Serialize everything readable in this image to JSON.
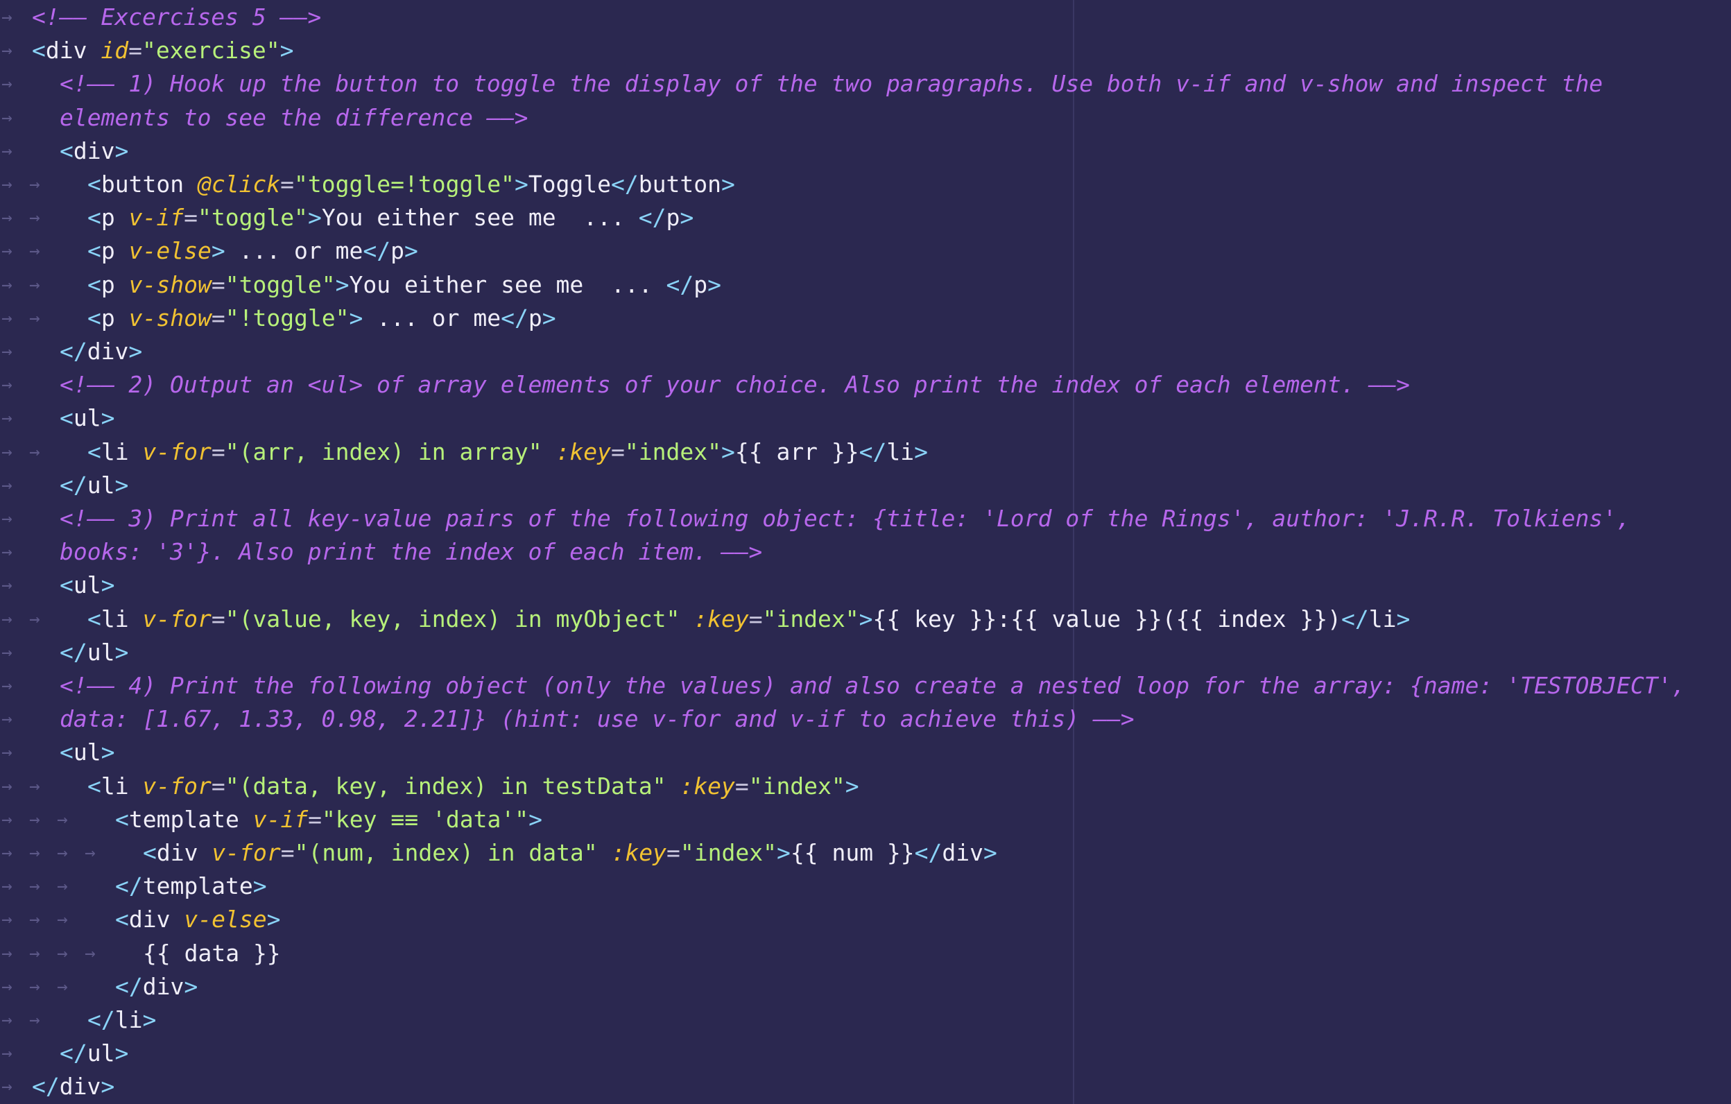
{
  "editor": {
    "indent_glyph": "→",
    "lines": [
      {
        "indent": 0,
        "tokens": [
          {
            "t": "<!—— Excercises 5 ——>",
            "k": "cm"
          }
        ]
      },
      {
        "indent": 0,
        "tokens": [
          {
            "t": "<",
            "k": "br"
          },
          {
            "t": "div ",
            "k": "tg"
          },
          {
            "t": "id",
            "k": "at"
          },
          {
            "t": "=",
            "k": "eq"
          },
          {
            "t": "\"exercise\"",
            "k": "st"
          },
          {
            "t": ">",
            "k": "br"
          }
        ]
      },
      {
        "indent": 1,
        "tokens": [
          {
            "t": "<!—— 1) Hook up the button to toggle the display of the two paragraphs. Use both v-if and v-show and inspect the",
            "k": "cm"
          }
        ]
      },
      {
        "indent": 1,
        "wrap": true,
        "tokens": [
          {
            "t": "elements to see the difference ——>",
            "k": "cm"
          }
        ]
      },
      {
        "indent": 1,
        "tokens": [
          {
            "t": "<",
            "k": "br"
          },
          {
            "t": "div",
            "k": "tg"
          },
          {
            "t": ">",
            "k": "br"
          }
        ]
      },
      {
        "indent": 2,
        "tokens": [
          {
            "t": "<",
            "k": "br"
          },
          {
            "t": "button ",
            "k": "tg"
          },
          {
            "t": "@click",
            "k": "at"
          },
          {
            "t": "=",
            "k": "eq"
          },
          {
            "t": "\"toggle=!toggle\"",
            "k": "st"
          },
          {
            "t": ">",
            "k": "br"
          },
          {
            "t": "Toggle",
            "k": "tx"
          },
          {
            "t": "</",
            "k": "br"
          },
          {
            "t": "button",
            "k": "tg"
          },
          {
            "t": ">",
            "k": "br"
          }
        ]
      },
      {
        "indent": 2,
        "tokens": [
          {
            "t": "<",
            "k": "br"
          },
          {
            "t": "p ",
            "k": "tg"
          },
          {
            "t": "v-if",
            "k": "at"
          },
          {
            "t": "=",
            "k": "eq"
          },
          {
            "t": "\"toggle\"",
            "k": "st"
          },
          {
            "t": ">",
            "k": "br"
          },
          {
            "t": "You either see me  ... ",
            "k": "tx"
          },
          {
            "t": "</",
            "k": "br"
          },
          {
            "t": "p",
            "k": "tg"
          },
          {
            "t": ">",
            "k": "br"
          }
        ]
      },
      {
        "indent": 2,
        "tokens": [
          {
            "t": "<",
            "k": "br"
          },
          {
            "t": "p ",
            "k": "tg"
          },
          {
            "t": "v-else",
            "k": "at"
          },
          {
            "t": ">",
            "k": "br"
          },
          {
            "t": " ... or me",
            "k": "tx"
          },
          {
            "t": "</",
            "k": "br"
          },
          {
            "t": "p",
            "k": "tg"
          },
          {
            "t": ">",
            "k": "br"
          }
        ]
      },
      {
        "indent": 2,
        "tokens": [
          {
            "t": "<",
            "k": "br"
          },
          {
            "t": "p ",
            "k": "tg"
          },
          {
            "t": "v-show",
            "k": "at"
          },
          {
            "t": "=",
            "k": "eq"
          },
          {
            "t": "\"toggle\"",
            "k": "st"
          },
          {
            "t": ">",
            "k": "br"
          },
          {
            "t": "You either see me  ... ",
            "k": "tx"
          },
          {
            "t": "</",
            "k": "br"
          },
          {
            "t": "p",
            "k": "tg"
          },
          {
            "t": ">",
            "k": "br"
          }
        ]
      },
      {
        "indent": 2,
        "tokens": [
          {
            "t": "<",
            "k": "br"
          },
          {
            "t": "p ",
            "k": "tg"
          },
          {
            "t": "v-show",
            "k": "at"
          },
          {
            "t": "=",
            "k": "eq"
          },
          {
            "t": "\"!toggle\"",
            "k": "st"
          },
          {
            "t": ">",
            "k": "br"
          },
          {
            "t": " ... or me",
            "k": "tx"
          },
          {
            "t": "</",
            "k": "br"
          },
          {
            "t": "p",
            "k": "tg"
          },
          {
            "t": ">",
            "k": "br"
          }
        ]
      },
      {
        "indent": 1,
        "tokens": [
          {
            "t": "</",
            "k": "br"
          },
          {
            "t": "div",
            "k": "tg"
          },
          {
            "t": ">",
            "k": "br"
          }
        ]
      },
      {
        "indent": 1,
        "tokens": [
          {
            "t": "<!—— 2) Output an <ul> of array elements of your choice. Also print the index of each element. ——>",
            "k": "cm"
          }
        ]
      },
      {
        "indent": 1,
        "tokens": [
          {
            "t": "<",
            "k": "br"
          },
          {
            "t": "ul",
            "k": "tg"
          },
          {
            "t": ">",
            "k": "br"
          }
        ]
      },
      {
        "indent": 2,
        "tokens": [
          {
            "t": "<",
            "k": "br"
          },
          {
            "t": "li ",
            "k": "tg"
          },
          {
            "t": "v-for",
            "k": "at"
          },
          {
            "t": "=",
            "k": "eq"
          },
          {
            "t": "\"(arr, index) in array\" ",
            "k": "st"
          },
          {
            "t": ":key",
            "k": "at"
          },
          {
            "t": "=",
            "k": "eq"
          },
          {
            "t": "\"index\"",
            "k": "st"
          },
          {
            "t": ">",
            "k": "br"
          },
          {
            "t": "{{ arr }}",
            "k": "tx"
          },
          {
            "t": "</",
            "k": "br"
          },
          {
            "t": "li",
            "k": "tg"
          },
          {
            "t": ">",
            "k": "br"
          }
        ]
      },
      {
        "indent": 1,
        "tokens": [
          {
            "t": "</",
            "k": "br"
          },
          {
            "t": "ul",
            "k": "tg"
          },
          {
            "t": ">",
            "k": "br"
          }
        ]
      },
      {
        "indent": 1,
        "tokens": [
          {
            "t": "<!—— 3) Print all key-value pairs of the following object: {title: 'Lord of the Rings', author: 'J.R.R. Tolkiens',",
            "k": "cm"
          }
        ]
      },
      {
        "indent": 1,
        "wrap": true,
        "tokens": [
          {
            "t": "books: '3'}. Also print the index of each item. ——>",
            "k": "cm"
          }
        ]
      },
      {
        "indent": 1,
        "tokens": [
          {
            "t": "<",
            "k": "br"
          },
          {
            "t": "ul",
            "k": "tg"
          },
          {
            "t": ">",
            "k": "br"
          }
        ]
      },
      {
        "indent": 2,
        "tokens": [
          {
            "t": "<",
            "k": "br"
          },
          {
            "t": "li ",
            "k": "tg"
          },
          {
            "t": "v-for",
            "k": "at"
          },
          {
            "t": "=",
            "k": "eq"
          },
          {
            "t": "\"(value, key, index) in myObject\" ",
            "k": "st"
          },
          {
            "t": ":key",
            "k": "at"
          },
          {
            "t": "=",
            "k": "eq"
          },
          {
            "t": "\"index\"",
            "k": "st"
          },
          {
            "t": ">",
            "k": "br"
          },
          {
            "t": "{{ key }}:{{ value }}({{ index }})",
            "k": "tx"
          },
          {
            "t": "</",
            "k": "br"
          },
          {
            "t": "li",
            "k": "tg"
          },
          {
            "t": ">",
            "k": "br"
          }
        ]
      },
      {
        "indent": 1,
        "tokens": [
          {
            "t": "</",
            "k": "br"
          },
          {
            "t": "ul",
            "k": "tg"
          },
          {
            "t": ">",
            "k": "br"
          }
        ]
      },
      {
        "indent": 1,
        "tokens": [
          {
            "t": "<!—— 4) Print the following object (only the values) and also create a nested loop for the array: {name: 'TESTOBJECT',",
            "k": "cm"
          }
        ]
      },
      {
        "indent": 1,
        "wrap": true,
        "tokens": [
          {
            "t": "data: [1.67, 1.33, 0.98, 2.21]} (hint: use v-for and v-if to achieve this) ——>",
            "k": "cm"
          }
        ]
      },
      {
        "indent": 1,
        "tokens": [
          {
            "t": "<",
            "k": "br"
          },
          {
            "t": "ul",
            "k": "tg"
          },
          {
            "t": ">",
            "k": "br"
          }
        ]
      },
      {
        "indent": 2,
        "tokens": [
          {
            "t": "<",
            "k": "br"
          },
          {
            "t": "li ",
            "k": "tg"
          },
          {
            "t": "v-for",
            "k": "at"
          },
          {
            "t": "=",
            "k": "eq"
          },
          {
            "t": "\"(data, key, index) in testData\" ",
            "k": "st"
          },
          {
            "t": ":key",
            "k": "at"
          },
          {
            "t": "=",
            "k": "eq"
          },
          {
            "t": "\"index\"",
            "k": "st"
          },
          {
            "t": ">",
            "k": "br"
          }
        ]
      },
      {
        "indent": 3,
        "tokens": [
          {
            "t": "<",
            "k": "br"
          },
          {
            "t": "template ",
            "k": "tg"
          },
          {
            "t": "v-if",
            "k": "at"
          },
          {
            "t": "=",
            "k": "eq"
          },
          {
            "t": "\"key ≡≡ 'data'\"",
            "k": "st"
          },
          {
            "t": ">",
            "k": "br"
          }
        ]
      },
      {
        "indent": 4,
        "tokens": [
          {
            "t": "<",
            "k": "br"
          },
          {
            "t": "div ",
            "k": "tg"
          },
          {
            "t": "v-for",
            "k": "at"
          },
          {
            "t": "=",
            "k": "eq"
          },
          {
            "t": "\"(num, index) in data\" ",
            "k": "st"
          },
          {
            "t": ":key",
            "k": "at"
          },
          {
            "t": "=",
            "k": "eq"
          },
          {
            "t": "\"index\"",
            "k": "st"
          },
          {
            "t": ">",
            "k": "br"
          },
          {
            "t": "{{ num }}",
            "k": "tx"
          },
          {
            "t": "</",
            "k": "br"
          },
          {
            "t": "div",
            "k": "tg"
          },
          {
            "t": ">",
            "k": "br"
          }
        ]
      },
      {
        "indent": 3,
        "tokens": [
          {
            "t": "</",
            "k": "br"
          },
          {
            "t": "template",
            "k": "tg"
          },
          {
            "t": ">",
            "k": "br"
          }
        ]
      },
      {
        "indent": 3,
        "tokens": [
          {
            "t": "<",
            "k": "br"
          },
          {
            "t": "div ",
            "k": "tg"
          },
          {
            "t": "v-else",
            "k": "at"
          },
          {
            "t": ">",
            "k": "br"
          }
        ]
      },
      {
        "indent": 4,
        "tokens": [
          {
            "t": "{{ data }}",
            "k": "tx"
          }
        ]
      },
      {
        "indent": 3,
        "tokens": [
          {
            "t": "</",
            "k": "br"
          },
          {
            "t": "div",
            "k": "tg"
          },
          {
            "t": ">",
            "k": "br"
          }
        ]
      },
      {
        "indent": 2,
        "tokens": [
          {
            "t": "</",
            "k": "br"
          },
          {
            "t": "li",
            "k": "tg"
          },
          {
            "t": ">",
            "k": "br"
          }
        ]
      },
      {
        "indent": 1,
        "tokens": [
          {
            "t": "</",
            "k": "br"
          },
          {
            "t": "ul",
            "k": "tg"
          },
          {
            "t": ">",
            "k": "br"
          }
        ]
      },
      {
        "indent": 0,
        "tokens": [
          {
            "t": "</",
            "k": "br"
          },
          {
            "t": "div",
            "k": "tg"
          },
          {
            "t": ">",
            "k": "br"
          }
        ]
      }
    ]
  }
}
